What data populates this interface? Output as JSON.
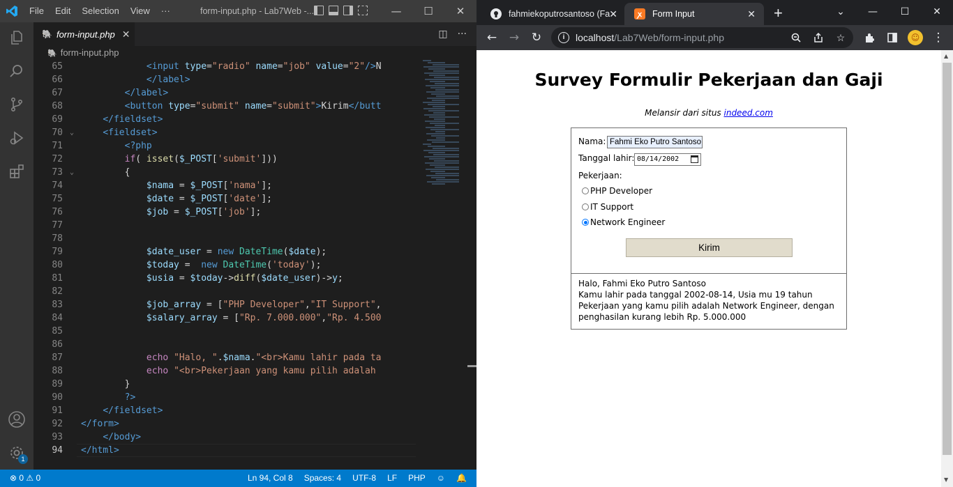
{
  "vscode": {
    "menu": [
      "File",
      "Edit",
      "Selection",
      "View",
      "···"
    ],
    "window_title": "form-input.php - Lab7Web -...",
    "tab": {
      "label": "form-input.php",
      "close": "✕"
    },
    "breadcrumb": "form-input.php",
    "lines": [
      {
        "n": "65",
        "html": "            <span class='t-tag'>&lt;input</span> <span class='t-attr'>type</span>=<span class='t-str'>\"radio\"</span> <span class='t-attr'>name</span>=<span class='t-str'>\"job\"</span> <span class='t-attr'>value</span>=<span class='t-str'>\"2\"</span><span class='t-tag'>/&gt;</span>N"
      },
      {
        "n": "66",
        "html": "            <span class='t-tag'>&lt;/label&gt;</span>"
      },
      {
        "n": "67",
        "html": "        <span class='t-tag'>&lt;/label&gt;</span>"
      },
      {
        "n": "68",
        "html": "        <span class='t-tag'>&lt;button</span> <span class='t-attr'>type</span>=<span class='t-str'>\"submit\"</span> <span class='t-attr'>name</span>=<span class='t-str'>\"submit\"</span><span class='t-tag'>&gt;</span>Kirim<span class='t-tag'>&lt;/butt</span>"
      },
      {
        "n": "69",
        "html": "    <span class='t-tag'>&lt;/fieldset&gt;</span>"
      },
      {
        "n": "70",
        "html": "    <span class='t-tag'>&lt;fieldset&gt;</span>",
        "fold": true
      },
      {
        "n": "71",
        "html": "        <span class='t-php'>&lt;?php</span>"
      },
      {
        "n": "72",
        "html": "        <span class='t-kw'>if</span>( <span class='t-fn'>isset</span>(<span class='t-var'>$_POST</span>[<span class='t-str'>'submit'</span>]))"
      },
      {
        "n": "73",
        "html": "        {",
        "fold": true
      },
      {
        "n": "74",
        "html": "            <span class='t-var'>$nama</span> = <span class='t-var'>$_POST</span>[<span class='t-str'>'nama'</span>];"
      },
      {
        "n": "75",
        "html": "            <span class='t-var'>$date</span> = <span class='t-var'>$_POST</span>[<span class='t-str'>'date'</span>];"
      },
      {
        "n": "76",
        "html": "            <span class='t-var'>$job</span> = <span class='t-var'>$_POST</span>[<span class='t-str'>'job'</span>];"
      },
      {
        "n": "77",
        "html": ""
      },
      {
        "n": "78",
        "html": ""
      },
      {
        "n": "79",
        "html": "            <span class='t-var'>$date_user</span> = <span class='t-php'>new</span> <span class='t-cls'>DateTime</span>(<span class='t-var'>$date</span>);"
      },
      {
        "n": "80",
        "html": "            <span class='t-var'>$today</span> =  <span class='t-php'>new</span> <span class='t-cls'>DateTime</span>(<span class='t-str'>'today'</span>);"
      },
      {
        "n": "81",
        "html": "            <span class='t-var'>$usia</span> = <span class='t-var'>$today</span>-&gt;<span class='t-fn'>diff</span>(<span class='t-var'>$date_user</span>)-&gt;<span class='t-var'>y</span>;"
      },
      {
        "n": "82",
        "html": ""
      },
      {
        "n": "83",
        "html": "            <span class='t-var'>$job_array</span> = [<span class='t-str'>\"PHP Developer\"</span>,<span class='t-str'>\"IT Support\"</span>,"
      },
      {
        "n": "84",
        "html": "            <span class='t-var'>$salary_array</span> = [<span class='t-str'>\"Rp. 7.000.000\"</span>,<span class='t-str'>\"Rp. 4.500</span>"
      },
      {
        "n": "85",
        "html": ""
      },
      {
        "n": "86",
        "html": ""
      },
      {
        "n": "87",
        "html": "            <span class='t-kw'>echo</span> <span class='t-str'>\"Halo, \"</span>.<span class='t-var'>$nama</span>.<span class='t-str'>\"&lt;br&gt;Kamu lahir pada ta</span>"
      },
      {
        "n": "88",
        "html": "            <span class='t-kw'>echo</span> <span class='t-str'>\"&lt;br&gt;Pekerjaan yang kamu pilih adalah</span>"
      },
      {
        "n": "89",
        "html": "        }"
      },
      {
        "n": "90",
        "html": "        <span class='t-php'>?&gt;</span>"
      },
      {
        "n": "91",
        "html": "    <span class='t-tag'>&lt;/fieldset&gt;</span>"
      },
      {
        "n": "92",
        "html": "<span class='t-tag'>&lt;/form&gt;</span>"
      },
      {
        "n": "93",
        "html": "    <span class='t-tag'>&lt;/body&gt;</span>"
      },
      {
        "n": "94",
        "html": "<span class='t-tag'>&lt;/html&gt;</span>",
        "active": true
      }
    ],
    "status": {
      "problems": "⊗ 0 ⚠ 0",
      "position": "Ln 94, Col 8",
      "spaces": "Spaces: 4",
      "encoding": "UTF-8",
      "eol": "LF",
      "language": "PHP"
    },
    "accounts_badge": "1",
    "colors": {
      "status_bar": "#007acc",
      "activity_bar": "#333333",
      "editor_bg": "#1e1e1e"
    }
  },
  "chrome": {
    "tabs": [
      {
        "title": "fahmiekoputrosantoso (Fa",
        "favicon": "github-icon"
      },
      {
        "title": "Form Input",
        "favicon": "xampp-icon"
      }
    ],
    "url_host": "localhost",
    "url_path": "/Lab7Web/form-input.php"
  },
  "page": {
    "title": "Survey Formulir Pekerjaan dan Gaji",
    "source_prefix": "Melansir dari situs ",
    "source_link": "indeed.com",
    "form": {
      "nama_label": "Nama:",
      "nama_value": "Fahmi Eko Putro Santoso",
      "date_label": "Tanggal lahir:",
      "date_value": "08/14/2002",
      "job_label": "Pekerjaan:",
      "jobs": [
        {
          "label": "PHP Developer",
          "checked": false
        },
        {
          "label": "IT Support",
          "checked": false
        },
        {
          "label": "Network Engineer",
          "checked": true
        }
      ],
      "submit_label": "Kirim"
    },
    "result": {
      "line1": "Halo, Fahmi Eko Putro Santoso",
      "line2": "Kamu lahir pada tanggal 2002-08-14, Usia mu 19 tahun",
      "line3": "Pekerjaan yang kamu pilih adalah Network Engineer, dengan penghasilan kurang lebih Rp. 5.000.000"
    }
  }
}
